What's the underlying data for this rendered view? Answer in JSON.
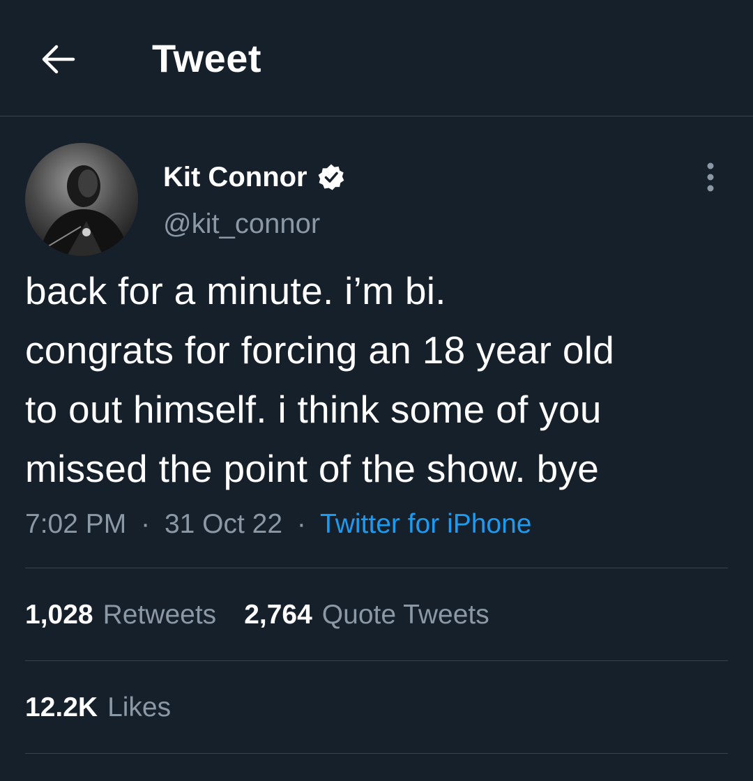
{
  "header": {
    "back_icon": "arrow-left-icon",
    "title": "Tweet"
  },
  "author": {
    "name": "Kit Connor",
    "handle": "@kit_connor",
    "verified_icon": "verified-badge-icon",
    "more_icon": "more-vertical-icon"
  },
  "tweet": {
    "lines": [
      "back for a minute. i’m bi.",
      "congrats for forcing an 18 year old",
      "to out himself. i think some of you",
      "missed the point of the show. bye"
    ],
    "time": "7:02 PM",
    "separator": "·",
    "date": "31 Oct 22",
    "source": "Twitter for iPhone"
  },
  "stats": {
    "retweets_count": "1,028",
    "retweets_label": "Retweets",
    "quotes_count": "2,764",
    "quotes_label": "Quote Tweets",
    "likes_count": "12.2K",
    "likes_label": "Likes"
  },
  "colors": {
    "background": "#15202b",
    "text": "#ffffff",
    "secondary_text": "#8b98a5",
    "link": "#1d9bf0",
    "divider": "#38444d"
  }
}
